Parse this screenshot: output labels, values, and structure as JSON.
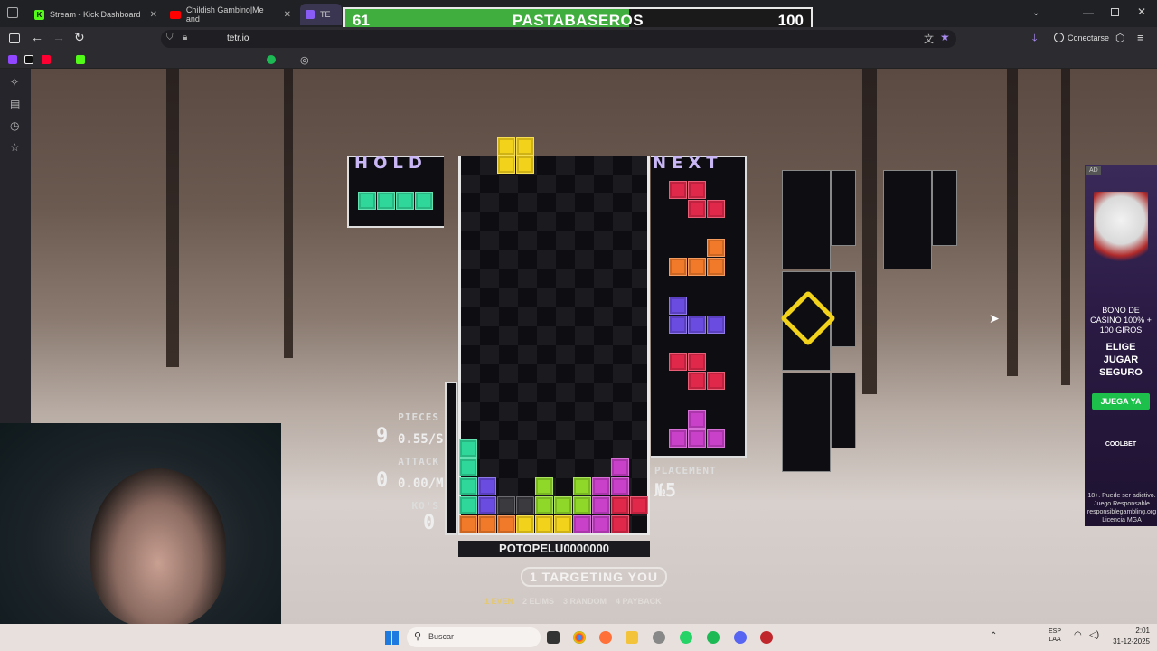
{
  "browser": {
    "tabs": [
      {
        "label": "Stream - Kick Dashboard",
        "icon": "kick-icon",
        "color": "#53fc18"
      },
      {
        "label": "Childish Gambino|Me and",
        "icon": "youtube-icon",
        "color": "#ff0000"
      },
      {
        "label": "TE",
        "icon": "tetrio-icon",
        "color": "#8a5cf6"
      }
    ],
    "url": "tetr.io",
    "connect_label": "Conectarse"
  },
  "versus_bar": {
    "left_value": "61",
    "team": "PASTABASEROS",
    "right_value": "100",
    "fill_fraction": 0.61,
    "fill_color": "#3fae3f"
  },
  "game": {
    "hold_label": "HOLD",
    "next_label": "NEXT",
    "stats": {
      "pieces_label": "PIECES",
      "pieces_value": "9",
      "pieces_rate": "0.55/S",
      "attack_label": "ATTACK",
      "attack_value": "0",
      "attack_rate": "0.00/M",
      "kos_label": "KO'S",
      "kos_value": "0"
    },
    "placement_label": "PLACEMENT",
    "placement_value": "№5",
    "player_name": "POTOPELU0000000",
    "targeting_text": "1 TARGETING YOU",
    "strategies": [
      {
        "label": "1 EVEN",
        "active": true
      },
      {
        "label": "2 ELIMS",
        "active": false
      },
      {
        "label": "3 RANDOM",
        "active": false
      },
      {
        "label": "4 PAYBACK",
        "active": false
      }
    ]
  },
  "ad": {
    "badge": "AD",
    "line1": "BONO DE CASINO 100% + 100 GIROS",
    "line2": "ELIGE JUGAR SEGURO",
    "button": "JUEGA YA",
    "brand": "COOLBET",
    "disclaimer": "18+. Puede ser adictivo. Juego Responsable responsiblegambling.org Licencia MGA"
  },
  "taskbar": {
    "search_placeholder": "Buscar",
    "lang_top": "ESP",
    "lang_bottom": "LAA",
    "time": "2:01",
    "date": "31-12-2025"
  }
}
